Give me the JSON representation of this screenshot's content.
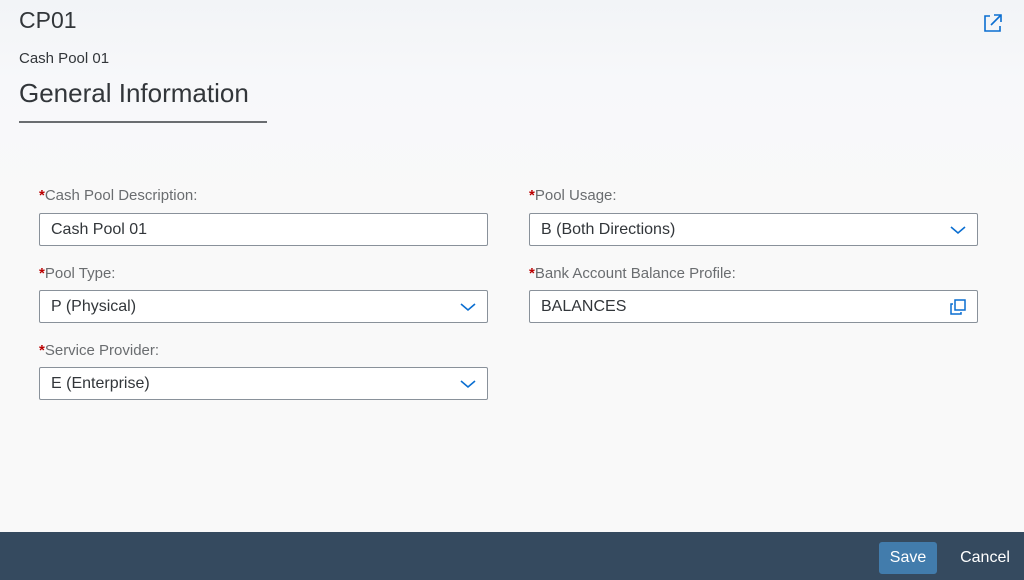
{
  "header": {
    "title": "CP01",
    "subtitle": "Cash Pool 01"
  },
  "section": {
    "title": "General Information"
  },
  "form": {
    "required_marker": "*",
    "cash_pool_description": {
      "label": "Cash Pool Description:",
      "value": "Cash Pool 01"
    },
    "pool_type": {
      "label": "Pool Type:",
      "value": "P (Physical)"
    },
    "service_provider": {
      "label": "Service Provider:",
      "value": "E (Enterprise)"
    },
    "pool_usage": {
      "label": "Pool Usage:",
      "value": "B (Both Directions)"
    },
    "bank_account_balance_profile": {
      "label": "Bank Account Balance Profile:",
      "value": "BALANCES"
    }
  },
  "footer": {
    "save_label": "Save",
    "cancel_label": "Cancel"
  },
  "icons": {
    "share": "share-icon",
    "dropdown": "chevron-down-icon",
    "value_help": "value-help-icon"
  },
  "colors": {
    "accent": "#427cac",
    "footer_bg": "#354a5f",
    "required": "#bb0000",
    "icon": "#0a6ed1"
  }
}
